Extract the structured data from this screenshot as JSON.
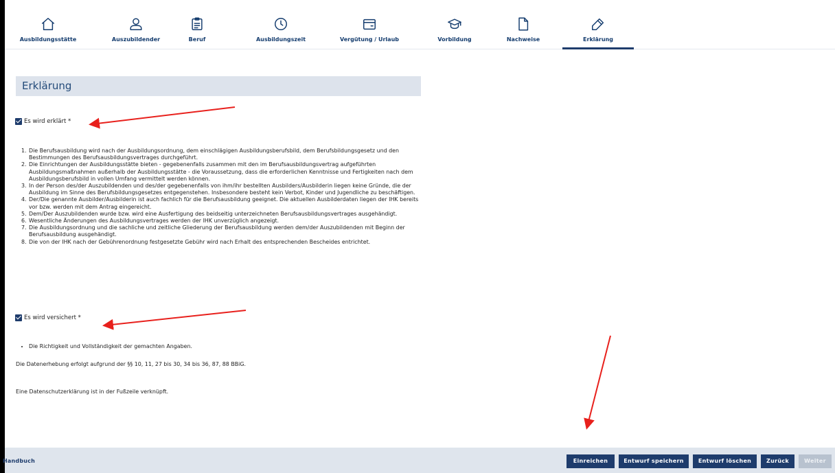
{
  "steps": [
    {
      "label": "Ausbildungsstätte",
      "icon": "home-icon"
    },
    {
      "label": "Auszubildender",
      "icon": "user-icon"
    },
    {
      "label": "Beruf",
      "icon": "clipboard-icon"
    },
    {
      "label": "Ausbildungszeit",
      "icon": "clock-icon"
    },
    {
      "label": "Vergütung / Urlaub",
      "icon": "wallet-icon"
    },
    {
      "label": "Vorbildung",
      "icon": "graduation-cap-icon"
    },
    {
      "label": "Nachweise",
      "icon": "document-icon"
    },
    {
      "label": "Erklärung",
      "icon": "pen-icon"
    }
  ],
  "active_step": "Erklärung",
  "section": {
    "title": "Erklärung"
  },
  "declaration": {
    "checkbox_label": "Es wird erklärt *",
    "checked": true,
    "items": [
      "Die Berufsausbildung wird nach der Ausbildungsordnung, dem einschlägigen Ausbildungsberufsbild, dem Berufsbildungsgesetz und den Bestimmungen des Berufsausbildungsvertrages durchgeführt.",
      "Die Einrichtungen der Ausbildungsstätte bieten - gegebenenfalls zusammen mit den im Berufsausbildungsvertrag aufgeführten Ausbildungsmaßnahmen außerhalb der Ausbildungsstätte - die Voraussetzung, dass die erforderlichen Kenntnisse und Fertigkeiten nach dem Ausbildungsberufsbild in vollen Umfang vermittelt werden können.",
      "In der Person des/der Auszubildenden und des/der gegebenenfalls von ihm/ihr bestellten Ausbilders/Ausbilderin liegen keine Gründe, die der Ausbildung im Sinne des Berufsbildungsgesetzes entgegenstehen. Insbesondere besteht kein Verbot, Kinder und Jugendliche zu beschäftigen.",
      "Der/Die genannte Ausbilder/Ausbilderin ist auch fachlich für die Berufsausbildung geeignet. Die aktuellen Ausbilderdaten liegen der IHK bereits vor bzw. werden mit dem Antrag eingereicht.",
      "Dem/Der Auszubildenden wurde bzw. wird eine Ausfertigung des beidseitig unterzeichneten Berufsausbildungsvertrages ausgehändigt.",
      "Wesentliche Änderungen des Ausbildungsvertrages werden der IHK unverzüglich angezeigt.",
      "Die Ausbildungsordnung und die sachliche und zeitliche Gliederung der Berufsausbildung werden dem/der Auszubildenden mit Beginn der Berufsausbildung ausgehändigt.",
      "Die von der IHK nach der Gebührenordnung festgesetzte Gebühr wird nach Erhalt des entsprechenden Bescheides entrichtet."
    ]
  },
  "assurance": {
    "checkbox_label": "Es wird versichert *",
    "checked": true,
    "items": [
      "Die Richtigkeit und Vollständigkeit der gemachten Angaben."
    ]
  },
  "legal_note": "Die Datenerhebung erfolgt aufgrund der §§ 10, 11, 27 bis 30, 34 bis 36, 87, 88 BBiG.",
  "privacy_note": "Eine Datenschutzerklärung ist in der Fußzeile verknüpft.",
  "footer": {
    "handbook_link": "Handbuch",
    "buttons": {
      "submit": "Einreichen",
      "save_draft": "Entwurf speichern",
      "delete_draft": "Entwurf löschen",
      "back": "Zurück",
      "next": "Weiter"
    },
    "next_disabled": true
  },
  "annotation_color": "#e8201c"
}
